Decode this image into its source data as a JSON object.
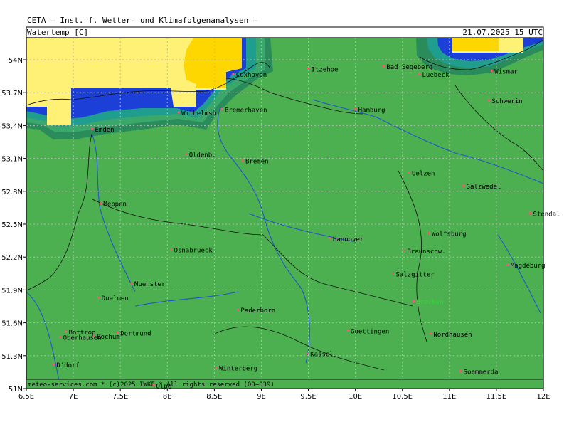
{
  "header": {
    "institute": "CETA – Inst. f. Wetter– und Klimafolgenanalysen –",
    "variable": "Watertemp [C]",
    "datetime": "21.07.2025 15 UTC"
  },
  "footer": {
    "credit": "meteo-services.com * (c)2025 IWKF * All rights reserved (00+039)"
  },
  "colors": {
    "land": "#4caf50",
    "sea_warm": "#fff176",
    "sea_hot": "#ffd700",
    "sea_cold": "#1c3fd8",
    "coast_band": "#2b8c5b",
    "river": "#2255cc"
  },
  "axes": {
    "lon_labels": [
      "6.5E",
      "7E",
      "7.5E",
      "8E",
      "8.5E",
      "9E",
      "9.5E",
      "10E",
      "10.5E",
      "11E",
      "11.5E",
      "12E"
    ],
    "lat_labels": [
      "54N",
      "53.7N",
      "53.4N",
      "53.1N",
      "52.8N",
      "52.5N",
      "52.2N",
      "51.9N",
      "51.6N",
      "51.3N",
      "51N"
    ]
  },
  "cities": [
    {
      "name": "Itzehoe",
      "lon": 9.5,
      "lat": 53.92
    },
    {
      "name": "Bad Segeberg",
      "lon": 10.3,
      "lat": 53.94
    },
    {
      "name": "Luebeck",
      "lon": 10.68,
      "lat": 53.87
    },
    {
      "name": "Wismar",
      "lon": 11.45,
      "lat": 53.9
    },
    {
      "name": "Cuxhaven",
      "lon": 8.7,
      "lat": 53.87
    },
    {
      "name": "Wilhelmsh",
      "lon": 8.12,
      "lat": 53.52
    },
    {
      "name": "Bremerhaven",
      "lon": 8.58,
      "lat": 53.55
    },
    {
      "name": "Hamburg",
      "lon": 10.0,
      "lat": 53.55
    },
    {
      "name": "Schwerin",
      "lon": 11.42,
      "lat": 53.63
    },
    {
      "name": "Emden",
      "lon": 7.2,
      "lat": 53.37
    },
    {
      "name": "Oldenb.",
      "lon": 8.2,
      "lat": 53.14
    },
    {
      "name": "Bremen",
      "lon": 8.8,
      "lat": 53.08
    },
    {
      "name": "Uelzen",
      "lon": 10.57,
      "lat": 52.97
    },
    {
      "name": "Salzwedel",
      "lon": 11.15,
      "lat": 52.85
    },
    {
      "name": "Meppen",
      "lon": 7.29,
      "lat": 52.69
    },
    {
      "name": "Stendal",
      "lon": 11.86,
      "lat": 52.6
    },
    {
      "name": "Hannover",
      "lon": 9.73,
      "lat": 52.37
    },
    {
      "name": "Wolfsburg",
      "lon": 10.78,
      "lat": 52.42
    },
    {
      "name": "Osnabrueck",
      "lon": 8.04,
      "lat": 52.27
    },
    {
      "name": "Braunschw.",
      "lon": 10.52,
      "lat": 52.26
    },
    {
      "name": "Magdeburg",
      "lon": 11.62,
      "lat": 52.13
    },
    {
      "name": "Salzgitter",
      "lon": 10.4,
      "lat": 52.05
    },
    {
      "name": "Muenster",
      "lon": 7.62,
      "lat": 51.96
    },
    {
      "name": "Duelmen",
      "lon": 7.27,
      "lat": 51.83
    },
    {
      "name": "Paderborn",
      "lon": 8.75,
      "lat": 51.72
    },
    {
      "name": "Bottrop",
      "lon": 6.92,
      "lat": 51.52
    },
    {
      "name": "Oberhausen",
      "lon": 6.86,
      "lat": 51.47
    },
    {
      "name": "Bochum",
      "lon": 7.22,
      "lat": 51.48
    },
    {
      "name": "Dortmund",
      "lon": 7.47,
      "lat": 51.51
    },
    {
      "name": "Goettingen",
      "lon": 9.92,
      "lat": 51.53
    },
    {
      "name": "Nordhausen",
      "lon": 10.8,
      "lat": 51.5
    },
    {
      "name": "Kassel",
      "lon": 9.49,
      "lat": 51.32
    },
    {
      "name": "D'dorf",
      "lon": 6.79,
      "lat": 51.22
    },
    {
      "name": "Winterberg",
      "lon": 8.52,
      "lat": 51.19
    },
    {
      "name": "Soemmerda",
      "lon": 11.12,
      "lat": 51.16
    },
    {
      "name": "Olpe",
      "lon": 7.85,
      "lat": 51.03
    }
  ],
  "peaks": [
    {
      "name": "Brocken",
      "lon": 10.62,
      "lat": 51.8
    }
  ]
}
